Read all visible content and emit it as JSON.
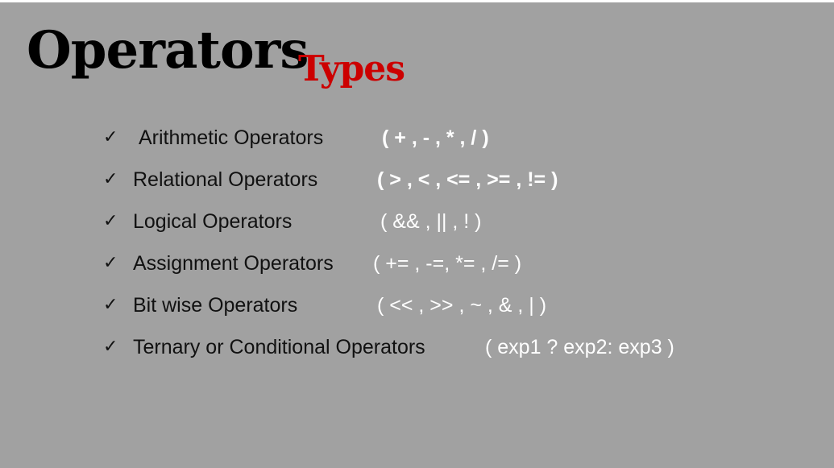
{
  "title": {
    "main": "Operators",
    "sub": "Types"
  },
  "items": [
    {
      "check": "✓",
      "label": "Arithmetic Operators",
      "ops": "( + , - , * , / )"
    },
    {
      "check": "✓",
      "label": "Relational Operators",
      "ops": "( > , < , <= , >= , != )"
    },
    {
      "check": "✓",
      "label": "Logical Operators",
      "ops": "( && ,  || , ! )"
    },
    {
      "check": "✓",
      "label": "Assignment Operators",
      "ops": "( += , -=, *= , /= )"
    },
    {
      "check": "✓",
      "label": "Bit wise Operators",
      "ops": "( << , >> , ~ , & , | )"
    },
    {
      "check": "✓",
      "label": "Ternary or Conditional Operators",
      "ops": "(  exp1 ? exp2: exp3 )"
    }
  ],
  "colors": {
    "background": "#a1a1a1",
    "title": "#000000",
    "subtitle": "#cc0000",
    "operators": "#ffffff"
  }
}
